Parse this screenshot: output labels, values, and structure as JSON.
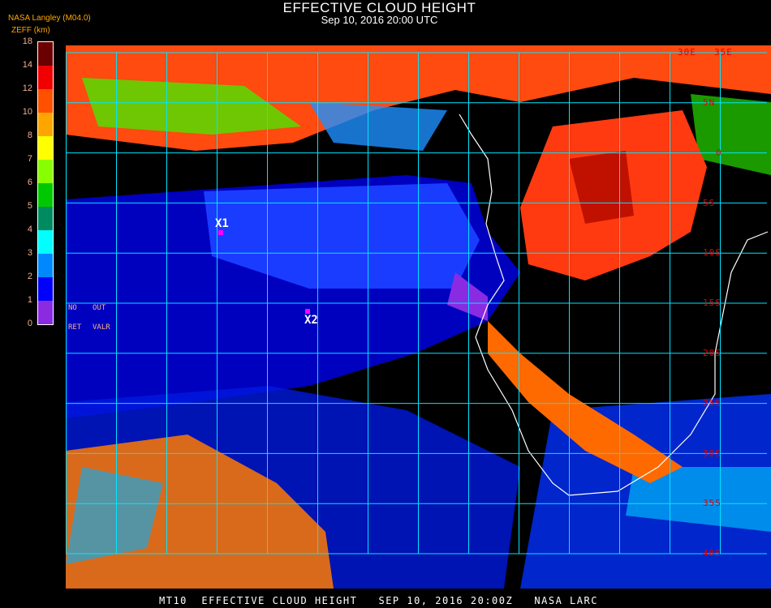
{
  "header": {
    "title": "EFFECTIVE CLOUD HEIGHT",
    "subtitle": "Sep 10, 2016 20:00 UTC",
    "organization": "NASA Langley (M04.0)",
    "unit_label": "ZEFF (km)"
  },
  "colorbar": {
    "ticks": [
      "18",
      "14",
      "12",
      "10",
      "8",
      "7",
      "6",
      "5",
      "4",
      "3",
      "2",
      "1",
      "0"
    ],
    "colors": [
      "#6a0000",
      "#f00000",
      "#ff5000",
      "#ffa500",
      "#ffff00",
      "#88ff00",
      "#00c800",
      "#008a60",
      "#00ffff",
      "#0088ff",
      "#0000ff",
      "#8a2be2"
    ],
    "no_ret": [
      "NO",
      "RET"
    ],
    "out_valr": [
      "OUT",
      "VALR"
    ]
  },
  "map": {
    "lat_labels": [
      "5N",
      "0",
      "5S",
      "10S",
      "15S",
      "20S",
      "25S",
      "30S",
      "35S",
      "40S"
    ],
    "lon_labels": [
      "30E",
      "35E"
    ],
    "markers": [
      {
        "label": "X1"
      },
      {
        "label": "X2"
      }
    ],
    "grid_color": "#00e5ff",
    "marker_color": "#ff00ff"
  },
  "footer": "MT10  EFFECTIVE CLOUD HEIGHT   SEP 10, 2016 20:00Z   NASA LARC"
}
